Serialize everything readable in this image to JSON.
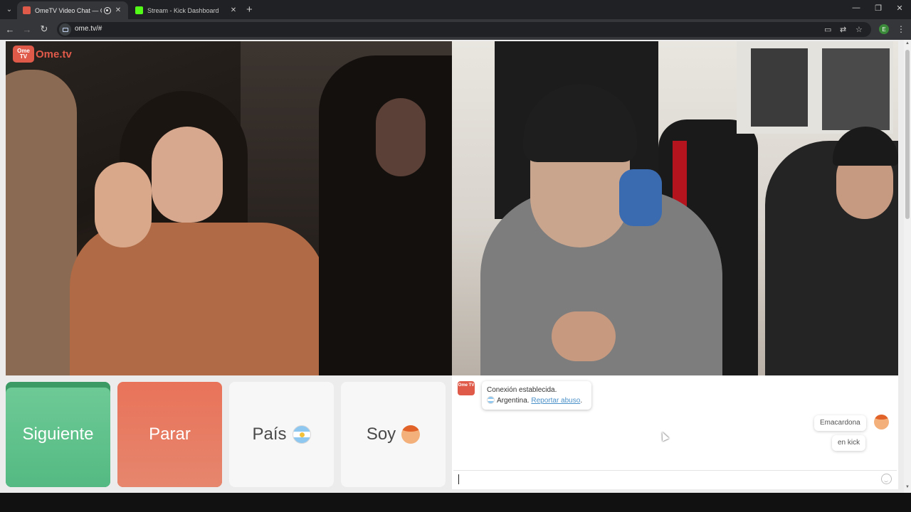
{
  "browser": {
    "tabs": [
      {
        "title": "OmeTV Video Chat — Ome",
        "active": true,
        "favicon_color": "#e05a4a"
      },
      {
        "title": "Stream - Kick Dashboard",
        "active": false,
        "favicon_color": "#53fc18"
      }
    ],
    "url": "ome.tv/#",
    "profile_initial": "E",
    "icons": [
      "tab-search-icon",
      "record-icon",
      "close-icon",
      "new-tab-icon",
      "minimize-icon",
      "restore-icon",
      "window-close-icon",
      "back-icon",
      "forward-icon",
      "reload-icon",
      "site-info-icon",
      "cast-icon",
      "translate-icon",
      "bookmark-star-icon",
      "menu-kebab-icon"
    ]
  },
  "logo": {
    "badge": "Ome TV",
    "text": "Ome.tv"
  },
  "controls": {
    "next_label": "Siguiente",
    "stop_label": "Parar",
    "country_label": "País",
    "gender_label": "Soy"
  },
  "chat": {
    "system_icon": "Ome TV",
    "connection_text": "Conexión establecida.",
    "country": "Argentina.",
    "report_link": "Reportar abuso",
    "report_suffix": ".",
    "messages": [
      {
        "text": "Emacardona"
      },
      {
        "text": "en kick"
      }
    ],
    "input_value": ""
  },
  "colors": {
    "next": "#5dbf88",
    "stop": "#e87a61",
    "brand": "#e05a4a",
    "link": "#4a90c8"
  }
}
